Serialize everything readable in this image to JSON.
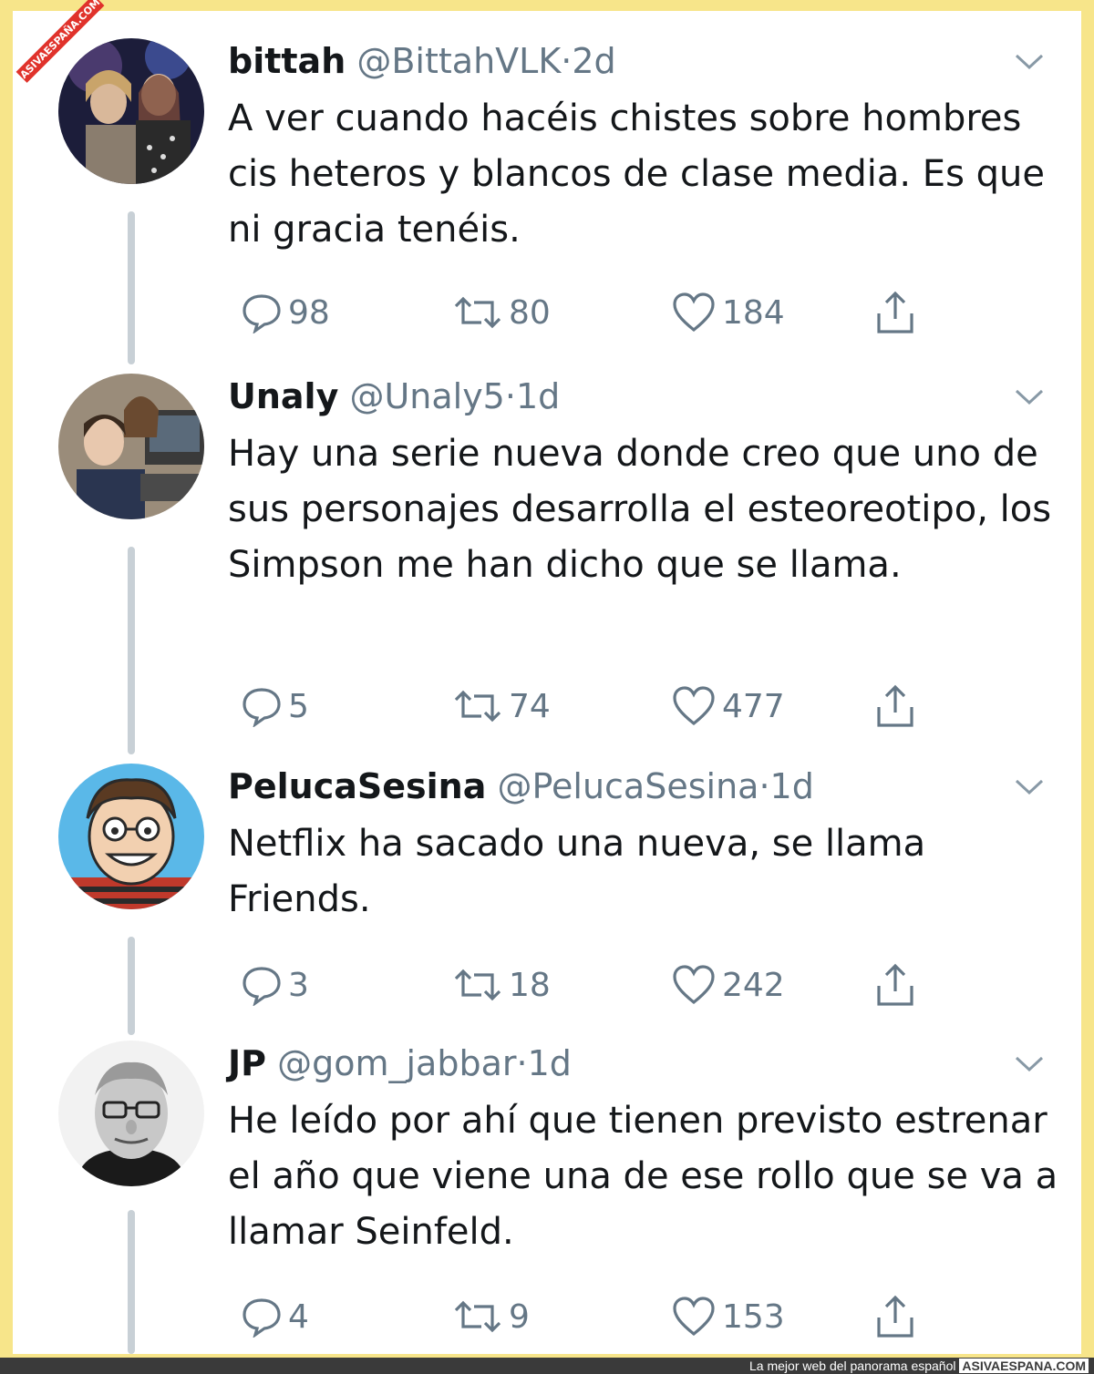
{
  "watermark": "ASIVAESPAÑA.COM",
  "tweets": [
    {
      "name": "bittah",
      "handle": "@BittahVLK",
      "separator": "·",
      "time": "2d",
      "text": "A ver cuando hacéis chistes sobre hombres cis heteros y blancos de clase media. Es que ni gracia tenéis.",
      "replies": "98",
      "retweets": "80",
      "likes": "184",
      "avatar_icon": "concert-photo-avatar"
    },
    {
      "name": "Unaly",
      "handle": "@Unaly5",
      "separator": "·",
      "time": "1d",
      "text": "Hay una serie nueva donde creo que uno de sus personajes desarrolla el esteoreotipo, los Simpson me han dicho que se llama.",
      "replies": "5",
      "retweets": "74",
      "likes": "477",
      "avatar_icon": "tv-still-avatar"
    },
    {
      "name": "PelucaSesina",
      "handle": "@PelucaSesina",
      "separator": "·",
      "time": "1d",
      "text": "Netflix ha sacado una nueva, se llama Friends.",
      "replies": "3",
      "retweets": "18",
      "likes": "242",
      "avatar_icon": "cartoon-face-avatar"
    },
    {
      "name": "JP",
      "handle": "@gom_jabbar",
      "separator": "·",
      "time": "1d",
      "text": "He leído por ahí que tienen previsto estrenar el año que viene una de ese rollo que se va a llamar Seinfeld.",
      "replies": "4",
      "retweets": "9",
      "likes": "153",
      "avatar_icon": "elderly-man-avatar"
    }
  ],
  "footer": {
    "tagline": "La mejor web del panorama español",
    "brand": "ASIVAESPANA.COM"
  },
  "colors": {
    "background": "#f7e58a",
    "text": "#14171a",
    "secondary": "#657786",
    "thread_line": "#c8d0d6"
  }
}
